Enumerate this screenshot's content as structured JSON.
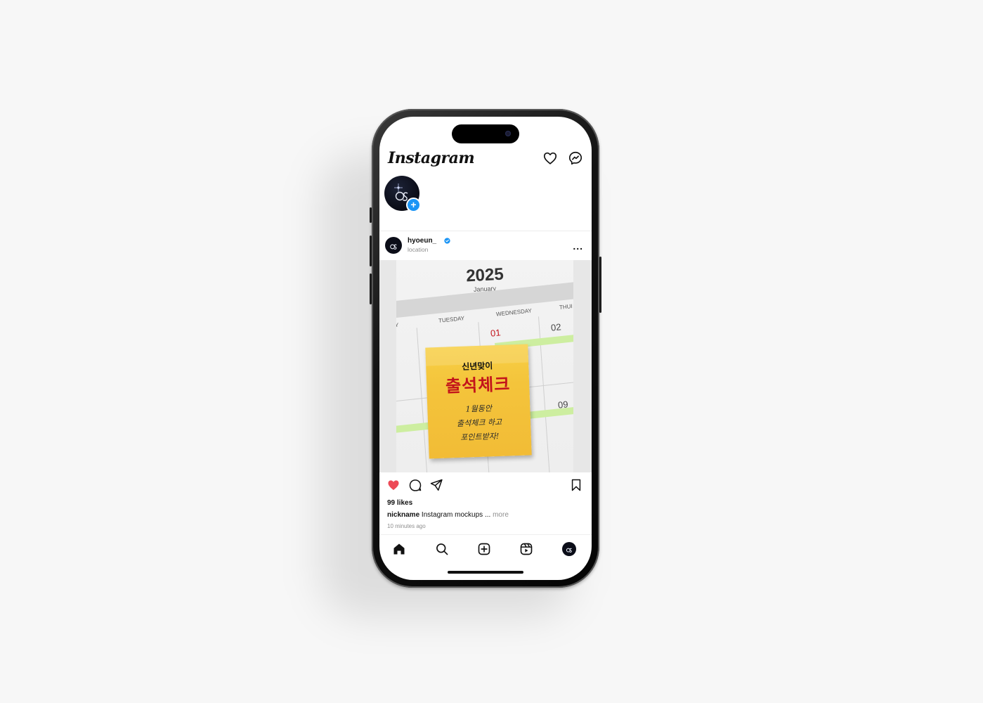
{
  "app": {
    "logo_text": "Instagram"
  },
  "post": {
    "username": "hyoeun_",
    "location": "location",
    "more_label": "...",
    "likes": "99 likes",
    "caption_user": "nickname",
    "caption_text": "Instagram mockups",
    "caption_ellipsis": "...",
    "caption_more": "more",
    "time_ago": "10 minutes ago",
    "liked": true
  },
  "image": {
    "year": "2025",
    "month": "January",
    "days": [
      "Y",
      "TUESDAY",
      "WEDNESDAY",
      "THUI"
    ],
    "dates": [
      "01",
      "02",
      "09"
    ],
    "sticky_line1": "신년맞이",
    "sticky_line2": "출석체크",
    "sticky_body": [
      "1월동안",
      "출석체크 하고",
      "포인트받자!"
    ]
  },
  "icons": {
    "header": [
      "heart-icon",
      "messenger-icon"
    ],
    "actions": [
      "heart-filled-icon",
      "comment-icon",
      "share-icon",
      "bookmark-icon"
    ],
    "nav": [
      "home-icon",
      "search-icon",
      "create-icon",
      "reels-icon",
      "profile-avatar"
    ]
  },
  "colors": {
    "like": "#ed4956",
    "verified": "#1b95f5",
    "sticky": "#f4c43b",
    "sticky_title": "#c3141b",
    "calendar_highlight": "#cdeea0"
  }
}
